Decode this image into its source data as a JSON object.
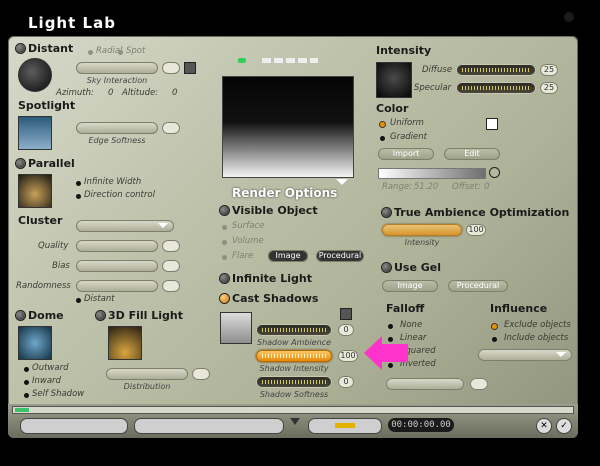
{
  "window": {
    "title": "Light Lab"
  },
  "left": {
    "distant": {
      "label": "Distant",
      "radial": "Radial",
      "spot": "Spot",
      "sky_interaction": "Sky Interaction",
      "azimuth_label": "Azimuth:",
      "azimuth_value": "0",
      "altitude_label": "Altitude:",
      "altitude_value": "0"
    },
    "spotlight": {
      "label": "Spotlight",
      "edge_softness": "Edge Softness"
    },
    "parallel": {
      "label": "Parallel",
      "infinite_width": "Infinite Width",
      "direction_control": "Direction control"
    },
    "cluster": {
      "label": "Cluster",
      "quality": "Quality",
      "bias": "Bias",
      "randomness": "Randomness",
      "distant": "Distant"
    },
    "dome": {
      "label": "Dome",
      "outward": "Outward",
      "inward": "Inward",
      "self_shadow": "Self Shadow"
    },
    "fill": {
      "label": "3D Fill Light",
      "distribution": "Distribution"
    }
  },
  "center": {
    "render_options": "Render Options",
    "visible_object": "Visible Object",
    "surface": "Surface",
    "volume": "Volume",
    "flare": "Flare",
    "image_btn": "Image",
    "procedural_btn": "Procedural",
    "infinite_light": "Infinite Light",
    "cast_shadows": "Cast Shadows",
    "shadow_ambience": "Shadow Ambience",
    "shadow_ambience_value": "0",
    "shadow_intensity": "Shadow Intensity",
    "shadow_intensity_value": "100",
    "shadow_softness": "Shadow Softness",
    "shadow_softness_value": "0"
  },
  "right": {
    "intensity": "Intensity",
    "diffuse": "Diffuse",
    "diffuse_value": "25",
    "specular": "Specular",
    "specular_value": "25",
    "color": "Color",
    "uniform": "Uniform",
    "gradient": "Gradient",
    "import_btn": "Import",
    "edit_btn": "Edit",
    "range_label": "Range:",
    "range_value": "51.20",
    "offset_label": "Offset:",
    "offset_value": "0",
    "true_ambience": "True Ambience Optimization",
    "intensity_small": "Intensity",
    "intensity_value": "100",
    "use_gel": "Use Gel",
    "image_btn": "Image",
    "procedural_btn": "Procedural",
    "falloff": "Falloff",
    "none": "None",
    "linear": "Linear",
    "squared": "Squared",
    "inverted": "Inverted",
    "influence": "Influence",
    "exclude": "Exclude objects",
    "include": "Include objects"
  },
  "bottom": {
    "timecode": "00:00:00.00"
  },
  "colors": {
    "accent": "#e69500",
    "highlight_arrow": "#ff33cc"
  }
}
